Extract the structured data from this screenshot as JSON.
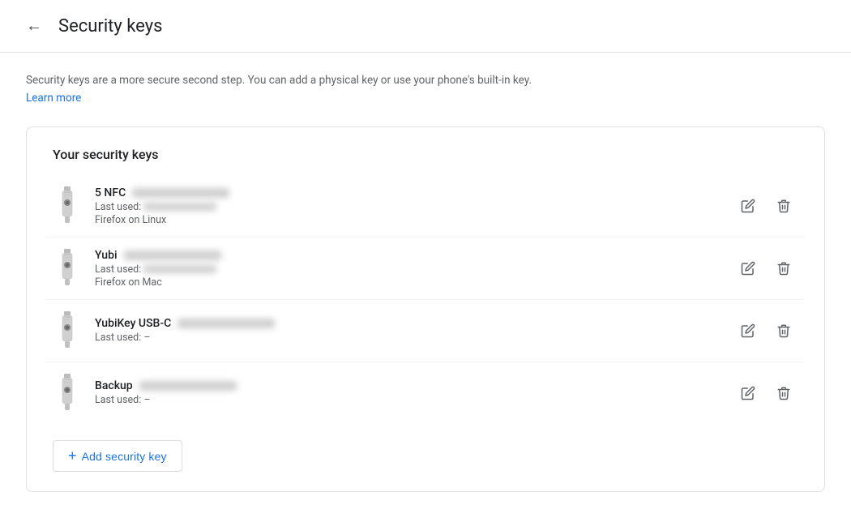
{
  "header": {
    "back_label": "←",
    "title": "Security keys"
  },
  "description": {
    "text": "Security keys are a more secure second step. You can add a physical key or use your phone's built-in key.",
    "learn_more_label": "Learn more"
  },
  "card": {
    "title": "Your security keys",
    "keys": [
      {
        "id": "key-1",
        "name": "5 NFC",
        "name_blur": true,
        "last_used_label": "Last used:",
        "last_used_blur": true,
        "browser": "Firefox on Linux",
        "edit_label": "Edit",
        "delete_label": "Delete"
      },
      {
        "id": "key-2",
        "name": "Yubi",
        "name_blur": true,
        "last_used_label": "Last used:",
        "last_used_blur": true,
        "browser": "Firefox on Mac",
        "edit_label": "Edit",
        "delete_label": "Delete"
      },
      {
        "id": "key-3",
        "name": "YubiKey USB-C",
        "name_blur": true,
        "last_used_label": "Last used: –",
        "last_used_blur": false,
        "browser": "",
        "edit_label": "Edit",
        "delete_label": "Delete"
      },
      {
        "id": "key-4",
        "name": "Backup",
        "name_blur": true,
        "last_used_label": "Last used: –",
        "last_used_blur": false,
        "browser": "",
        "edit_label": "Edit",
        "delete_label": "Delete"
      }
    ],
    "add_button_label": "Add security key"
  }
}
